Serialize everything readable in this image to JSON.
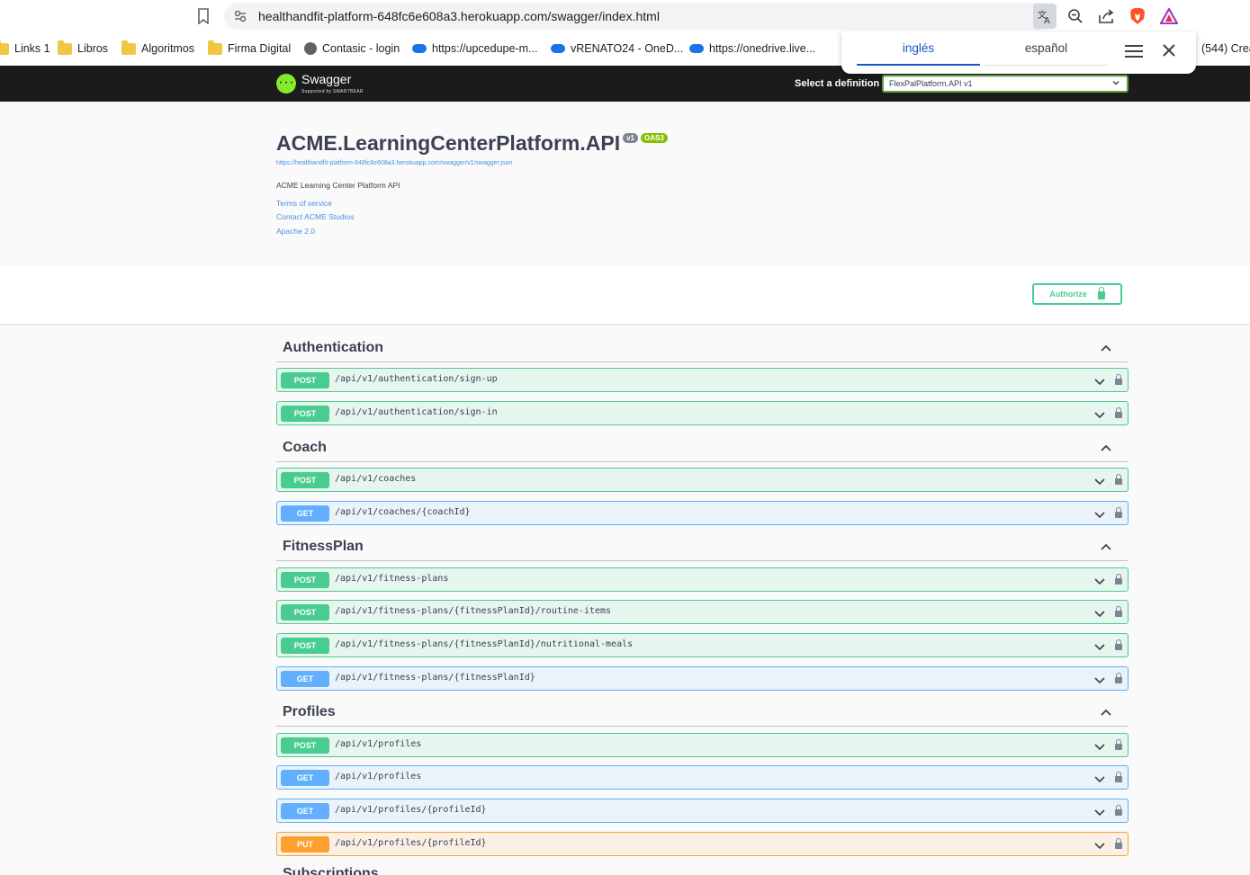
{
  "browser": {
    "url": "healthandfit-platform-648fc6e608a3.herokuapp.com/swagger/index.html",
    "bookmarks": [
      {
        "label": "Links 1",
        "icon": "folder-icon"
      },
      {
        "label": "Libros",
        "icon": "folder-icon"
      },
      {
        "label": "Algoritmos",
        "icon": "folder-icon"
      },
      {
        "label": "Firma Digital",
        "icon": "folder-icon"
      },
      {
        "label": "Contasic - login",
        "icon": "globe-icon"
      },
      {
        "label": "https://upcedupe-m...",
        "icon": "onedrive-icon"
      },
      {
        "label": "vRENATO24 - OneD...",
        "icon": "onedrive-icon"
      },
      {
        "label": "https://onedrive.live...",
        "icon": "onedrive-icon"
      },
      {
        "label": "(544) Crea",
        "icon": ""
      }
    ],
    "translate": {
      "lang_active": "inglés",
      "lang_other": "español"
    }
  },
  "topbar": {
    "logo_text": "Swagger",
    "logo_sub": "Supported by SMARTBEAR",
    "definition_label": "Select a definition",
    "definition_value": "FlexPalPlatform.API v1"
  },
  "info": {
    "title": "ACME.LearningCenterPlatform.API",
    "version_badge": "v1",
    "oas_badge": "OAS3",
    "swagger_url": "https://healthandfit-platform-648fc6e608a3.herokuapp.com/swagger/v1/swagger.json",
    "description": "ACME Learning Center Platform API",
    "terms": "Terms of service",
    "contact": "Contact ACME Studios",
    "license": "Apache 2.0"
  },
  "authorize_label": "Authorize",
  "tags": [
    {
      "name": "Authentication",
      "ops": [
        {
          "method": "POST",
          "path": "/api/v1/authentication/sign-up"
        },
        {
          "method": "POST",
          "path": "/api/v1/authentication/sign-in"
        }
      ]
    },
    {
      "name": "Coach",
      "ops": [
        {
          "method": "POST",
          "path": "/api/v1/coaches"
        },
        {
          "method": "GET",
          "path": "/api/v1/coaches/{coachId}"
        }
      ]
    },
    {
      "name": "FitnessPlan",
      "ops": [
        {
          "method": "POST",
          "path": "/api/v1/fitness-plans"
        },
        {
          "method": "POST",
          "path": "/api/v1/fitness-plans/{fitnessPlanId}/routine-items"
        },
        {
          "method": "POST",
          "path": "/api/v1/fitness-plans/{fitnessPlanId}/nutritional-meals"
        },
        {
          "method": "GET",
          "path": "/api/v1/fitness-plans/{fitnessPlanId}"
        }
      ]
    },
    {
      "name": "Profiles",
      "ops": [
        {
          "method": "POST",
          "path": "/api/v1/profiles"
        },
        {
          "method": "GET",
          "path": "/api/v1/profiles"
        },
        {
          "method": "GET",
          "path": "/api/v1/profiles/{profileId}"
        },
        {
          "method": "PUT",
          "path": "/api/v1/profiles/{profileId}"
        }
      ]
    }
  ],
  "next_tag": "Subscriptions"
}
